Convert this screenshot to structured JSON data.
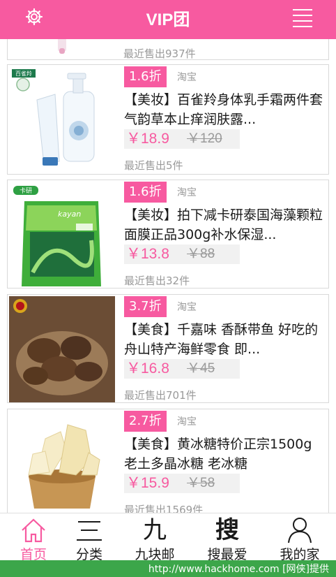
{
  "header": {
    "title": "VIP团",
    "left_icon": "gear-icon",
    "right_icon": "menu-icon"
  },
  "top_card": {
    "sold": "最近售出937件"
  },
  "products": [
    {
      "discount": "1.6折",
      "source": "淘宝",
      "title": "【美妆】百雀羚身体乳手霜两件套 气韵草本止痒润肤露...",
      "price": "￥18.9",
      "old_price": "￥120",
      "sold": "最近售出5件",
      "brand_tag": "百雀羚"
    },
    {
      "discount": "1.6折",
      "source": "淘宝",
      "title": "【美妆】拍下减卡研泰国海藻颗粒面膜正品300g补水保湿...",
      "price": "￥13.8",
      "old_price": "￥88",
      "sold": "最近售出32件",
      "brand_tag": "卡研",
      "pack_text": "kayan"
    },
    {
      "discount": "3.7折",
      "source": "淘宝",
      "title": "【美食】千嘉味 香酥带鱼 好吃的舟山特产海鲜零食 即...",
      "price": "￥16.8",
      "old_price": "￥45",
      "sold": "最近售出701件"
    },
    {
      "discount": "2.7折",
      "source": "淘宝",
      "title": "【美食】黄冰糖特价正宗1500g老土多晶冰糖 老冰糖",
      "price": "￥15.9",
      "old_price": "￥58",
      "sold": "最近售出1569件"
    }
  ],
  "tabs": [
    {
      "label": "首页",
      "icon": "home-icon",
      "active": true
    },
    {
      "label": "分类",
      "icon": "list-icon",
      "glyph": ""
    },
    {
      "label": "九块邮",
      "icon": "nine-icon",
      "glyph": "九"
    },
    {
      "label": "搜最爱",
      "icon": "search-icon",
      "glyph": "搜"
    },
    {
      "label": "我的家",
      "icon": "user-icon"
    }
  ],
  "watermark": "http://www.hackhome.com [网侠]提供",
  "colors": {
    "accent": "#f75aa0",
    "watermark_bg": "#3ca64a"
  }
}
